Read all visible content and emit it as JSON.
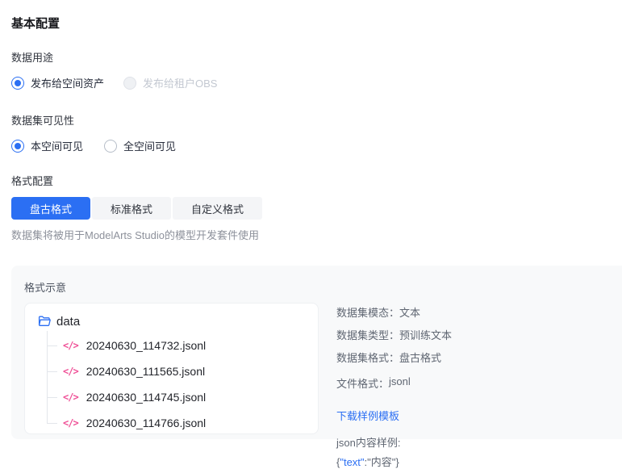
{
  "colors": {
    "accent": "#2b6ff3",
    "file_icon_pink": "#ef4f96",
    "panel_bg": "#f8f9fa"
  },
  "page": {
    "title": "基本配置"
  },
  "sections": {
    "data_usage": {
      "label": "数据用途",
      "options": [
        {
          "label": "发布给空间资产",
          "state": "selected"
        },
        {
          "label": "发布给租户OBS",
          "state": "disabled"
        }
      ]
    },
    "visibility": {
      "label": "数据集可见性",
      "options": [
        {
          "label": "本空间可见",
          "state": "selected"
        },
        {
          "label": "全空间可见",
          "state": "unselected"
        }
      ]
    },
    "format": {
      "label": "格式配置",
      "tabs": [
        {
          "label": "盘古格式",
          "active": true
        },
        {
          "label": "标准格式",
          "active": false
        },
        {
          "label": "自定义格式",
          "active": false
        }
      ],
      "helper": "数据集将被用于ModelArts Studio的模型开发套件使用"
    }
  },
  "preview": {
    "title": "格式示意",
    "tree": {
      "folder": "data",
      "file_icon": "</>",
      "files": [
        "20240630_114732.jsonl",
        "20240630_111565.jsonl",
        "20240630_114745.jsonl",
        "20240630_114766.jsonl"
      ]
    },
    "meta": [
      {
        "label": "数据集模态：",
        "value": "文本"
      },
      {
        "label": "数据集类型：",
        "value": "预训练文本"
      },
      {
        "label": "数据集格式：",
        "value": "盘古格式"
      },
      {
        "label": "文件格式：",
        "value": "jsonl"
      }
    ],
    "download_link": "下载样例模板",
    "json_sample_label": "json内容样例:",
    "json_sample": {
      "open": "{",
      "key": "\"text\"",
      "rest": ":\"内容\"}"
    }
  }
}
